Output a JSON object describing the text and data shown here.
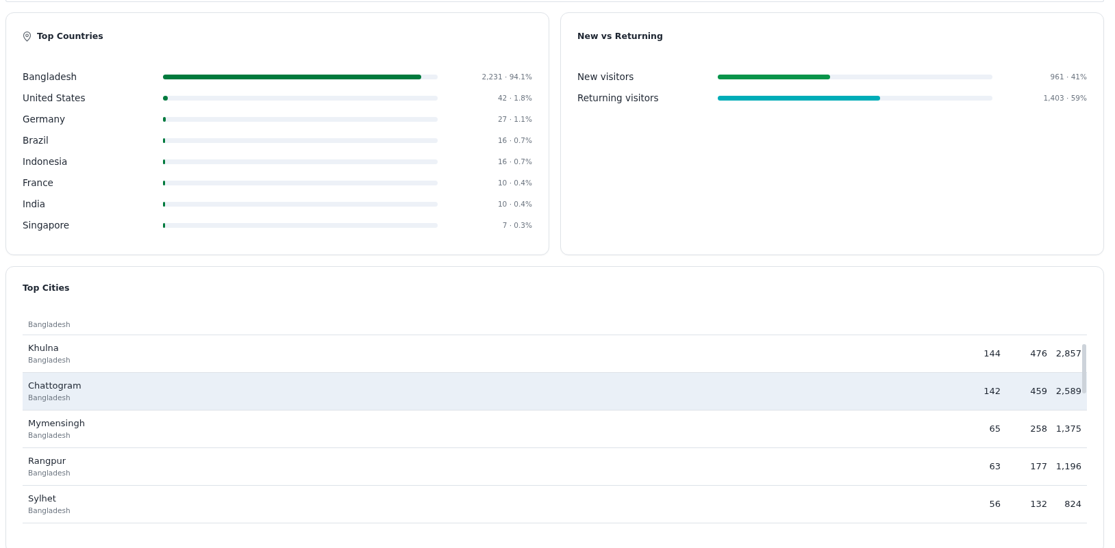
{
  "countries": {
    "title": "Top Countries",
    "items": [
      {
        "name": "Bangladesh",
        "level": 0.941,
        "reading": "2,231 · 94.1%"
      },
      {
        "name": "United States",
        "level": 0.018,
        "reading": "42 · 1.8%"
      },
      {
        "name": "Germany",
        "level": 0.011,
        "reading": "27 · 1.1%"
      },
      {
        "name": "Brazil",
        "level": 0.007,
        "reading": "16 · 0.7%"
      },
      {
        "name": "Indonesia",
        "level": 0.007,
        "reading": "16 · 0.7%"
      },
      {
        "name": "France",
        "level": 0.004,
        "reading": "10 · 0.4%"
      },
      {
        "name": "India",
        "level": 0.004,
        "reading": "10 · 0.4%"
      },
      {
        "name": "Singapore",
        "level": 0.003,
        "reading": "7 · 0.3%"
      }
    ]
  },
  "new_vs_returning": {
    "title": "New vs Returning",
    "items": [
      {
        "name": "New visitors",
        "level": 0.41,
        "reading": "961 · 41%",
        "color": "#08944a"
      },
      {
        "name": "Returning visitors",
        "level": 0.59,
        "reading": "1,403 · 59%",
        "color": "#00adb8"
      }
    ]
  },
  "cities": {
    "title": "Top Cities",
    "rows": [
      {
        "country": "Bangladesh",
        "selected": false
      },
      {
        "city": "Khulna",
        "country": "Bangladesh",
        "column_2": "144",
        "column_3": "476",
        "column_4": "2,857",
        "selected": false
      },
      {
        "city": "Chattogram",
        "country": "Bangladesh",
        "column_2": "142",
        "column_3": "459",
        "column_4": "2,589",
        "selected": true
      },
      {
        "city": "Mymensingh",
        "country": "Bangladesh",
        "column_2": "65",
        "column_3": "258",
        "column_4": "1,375",
        "selected": false
      },
      {
        "city": "Rangpur",
        "country": "Bangladesh",
        "column_2": "63",
        "column_3": "177",
        "column_4": "1,196",
        "selected": false
      },
      {
        "city": "Sylhet",
        "country": "Bangladesh",
        "column_2": "56",
        "column_3": "132",
        "column_4": "824",
        "selected": false
      }
    ]
  }
}
